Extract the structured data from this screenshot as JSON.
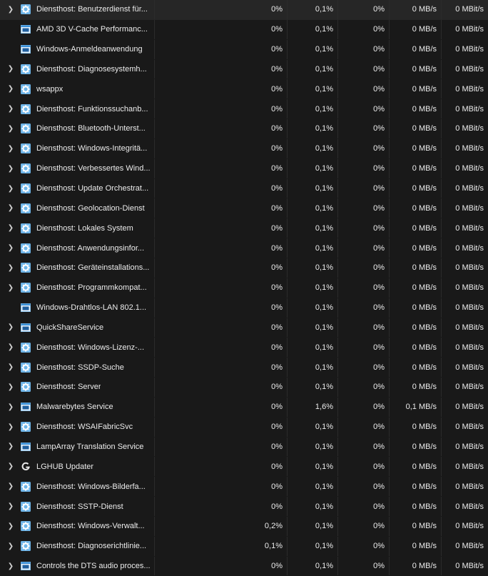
{
  "rows": [
    {
      "expand": true,
      "icon": "service-gear-icon",
      "name": "Diensthost: Benutzerdienst für...",
      "cpu": "0%",
      "mem": "0,1%",
      "disk": "0%",
      "net": "0 MB/s",
      "mbit": "0 MBit/s"
    },
    {
      "expand": false,
      "icon": "app-window-icon",
      "name": "AMD 3D V-Cache Performanc...",
      "cpu": "0%",
      "mem": "0,1%",
      "disk": "0%",
      "net": "0 MB/s",
      "mbit": "0 MBit/s"
    },
    {
      "expand": false,
      "icon": "app-window-icon",
      "name": "Windows-Anmeldeanwendung",
      "cpu": "0%",
      "mem": "0,1%",
      "disk": "0%",
      "net": "0 MB/s",
      "mbit": "0 MBit/s"
    },
    {
      "expand": true,
      "icon": "service-gear-icon",
      "name": "Diensthost: Diagnosesystemh...",
      "cpu": "0%",
      "mem": "0,1%",
      "disk": "0%",
      "net": "0 MB/s",
      "mbit": "0 MBit/s"
    },
    {
      "expand": true,
      "icon": "service-gear-icon",
      "name": "wsappx",
      "cpu": "0%",
      "mem": "0,1%",
      "disk": "0%",
      "net": "0 MB/s",
      "mbit": "0 MBit/s"
    },
    {
      "expand": true,
      "icon": "service-gear-icon",
      "name": "Diensthost: Funktionssuchanb...",
      "cpu": "0%",
      "mem": "0,1%",
      "disk": "0%",
      "net": "0 MB/s",
      "mbit": "0 MBit/s"
    },
    {
      "expand": true,
      "icon": "service-gear-icon",
      "name": "Diensthost: Bluetooth-Unterst...",
      "cpu": "0%",
      "mem": "0,1%",
      "disk": "0%",
      "net": "0 MB/s",
      "mbit": "0 MBit/s"
    },
    {
      "expand": true,
      "icon": "service-gear-icon",
      "name": "Diensthost: Windows-Integritä...",
      "cpu": "0%",
      "mem": "0,1%",
      "disk": "0%",
      "net": "0 MB/s",
      "mbit": "0 MBit/s"
    },
    {
      "expand": true,
      "icon": "service-gear-icon",
      "name": "Diensthost: Verbessertes Wind...",
      "cpu": "0%",
      "mem": "0,1%",
      "disk": "0%",
      "net": "0 MB/s",
      "mbit": "0 MBit/s"
    },
    {
      "expand": true,
      "icon": "service-gear-icon",
      "name": "Diensthost: Update Orchestrat...",
      "cpu": "0%",
      "mem": "0,1%",
      "disk": "0%",
      "net": "0 MB/s",
      "mbit": "0 MBit/s"
    },
    {
      "expand": true,
      "icon": "service-gear-icon",
      "name": "Diensthost: Geolocation-Dienst",
      "cpu": "0%",
      "mem": "0,1%",
      "disk": "0%",
      "net": "0 MB/s",
      "mbit": "0 MBit/s"
    },
    {
      "expand": true,
      "icon": "service-gear-icon",
      "name": "Diensthost: Lokales System",
      "cpu": "0%",
      "mem": "0,1%",
      "disk": "0%",
      "net": "0 MB/s",
      "mbit": "0 MBit/s"
    },
    {
      "expand": true,
      "icon": "service-gear-icon",
      "name": "Diensthost: Anwendungsinfor...",
      "cpu": "0%",
      "mem": "0,1%",
      "disk": "0%",
      "net": "0 MB/s",
      "mbit": "0 MBit/s"
    },
    {
      "expand": true,
      "icon": "service-gear-icon",
      "name": "Diensthost: Geräteinstallations...",
      "cpu": "0%",
      "mem": "0,1%",
      "disk": "0%",
      "net": "0 MB/s",
      "mbit": "0 MBit/s"
    },
    {
      "expand": true,
      "icon": "service-gear-icon",
      "name": "Diensthost: Programmkompat...",
      "cpu": "0%",
      "mem": "0,1%",
      "disk": "0%",
      "net": "0 MB/s",
      "mbit": "0 MBit/s"
    },
    {
      "expand": false,
      "icon": "app-window-icon",
      "name": "Windows-Drahtlos-LAN 802.1...",
      "cpu": "0%",
      "mem": "0,1%",
      "disk": "0%",
      "net": "0 MB/s",
      "mbit": "0 MBit/s"
    },
    {
      "expand": true,
      "icon": "app-window-icon",
      "name": "QuickShareService",
      "cpu": "0%",
      "mem": "0,1%",
      "disk": "0%",
      "net": "0 MB/s",
      "mbit": "0 MBit/s"
    },
    {
      "expand": true,
      "icon": "service-gear-icon",
      "name": "Diensthost: Windows-Lizenz-...",
      "cpu": "0%",
      "mem": "0,1%",
      "disk": "0%",
      "net": "0 MB/s",
      "mbit": "0 MBit/s"
    },
    {
      "expand": true,
      "icon": "service-gear-icon",
      "name": "Diensthost: SSDP-Suche",
      "cpu": "0%",
      "mem": "0,1%",
      "disk": "0%",
      "net": "0 MB/s",
      "mbit": "0 MBit/s"
    },
    {
      "expand": true,
      "icon": "service-gear-icon",
      "name": "Diensthost: Server",
      "cpu": "0%",
      "mem": "0,1%",
      "disk": "0%",
      "net": "0 MB/s",
      "mbit": "0 MBit/s"
    },
    {
      "expand": true,
      "icon": "app-window-icon",
      "name": "Malwarebytes Service",
      "cpu": "0%",
      "mem": "1,6%",
      "disk": "0%",
      "net": "0,1 MB/s",
      "mbit": "0 MBit/s"
    },
    {
      "expand": true,
      "icon": "service-gear-icon",
      "name": "Diensthost: WSAIFabricSvc",
      "cpu": "0%",
      "mem": "0,1%",
      "disk": "0%",
      "net": "0 MB/s",
      "mbit": "0 MBit/s"
    },
    {
      "expand": true,
      "icon": "app-window-icon",
      "name": "LampArray Translation Service",
      "cpu": "0%",
      "mem": "0,1%",
      "disk": "0%",
      "net": "0 MB/s",
      "mbit": "0 MBit/s"
    },
    {
      "expand": true,
      "icon": "logitech-g-icon",
      "name": "LGHUB Updater",
      "cpu": "0%",
      "mem": "0,1%",
      "disk": "0%",
      "net": "0 MB/s",
      "mbit": "0 MBit/s"
    },
    {
      "expand": true,
      "icon": "service-gear-icon",
      "name": "Diensthost: Windows-Bilderfa...",
      "cpu": "0%",
      "mem": "0,1%",
      "disk": "0%",
      "net": "0 MB/s",
      "mbit": "0 MBit/s"
    },
    {
      "expand": true,
      "icon": "service-gear-icon",
      "name": "Diensthost: SSTP-Dienst",
      "cpu": "0%",
      "mem": "0,1%",
      "disk": "0%",
      "net": "0 MB/s",
      "mbit": "0 MBit/s"
    },
    {
      "expand": true,
      "icon": "service-gear-icon",
      "name": "Diensthost: Windows-Verwalt...",
      "cpu": "0,2%",
      "mem": "0,1%",
      "disk": "0%",
      "net": "0 MB/s",
      "mbit": "0 MBit/s"
    },
    {
      "expand": true,
      "icon": "service-gear-icon",
      "name": "Diensthost: Diagnoserichtlinie...",
      "cpu": "0,1%",
      "mem": "0,1%",
      "disk": "0%",
      "net": "0 MB/s",
      "mbit": "0 MBit/s"
    },
    {
      "expand": true,
      "icon": "app-window-icon",
      "name": "Controls the DTS audio proces...",
      "cpu": "0%",
      "mem": "0,1%",
      "disk": "0%",
      "net": "0 MB/s",
      "mbit": "0 MBit/s"
    }
  ]
}
